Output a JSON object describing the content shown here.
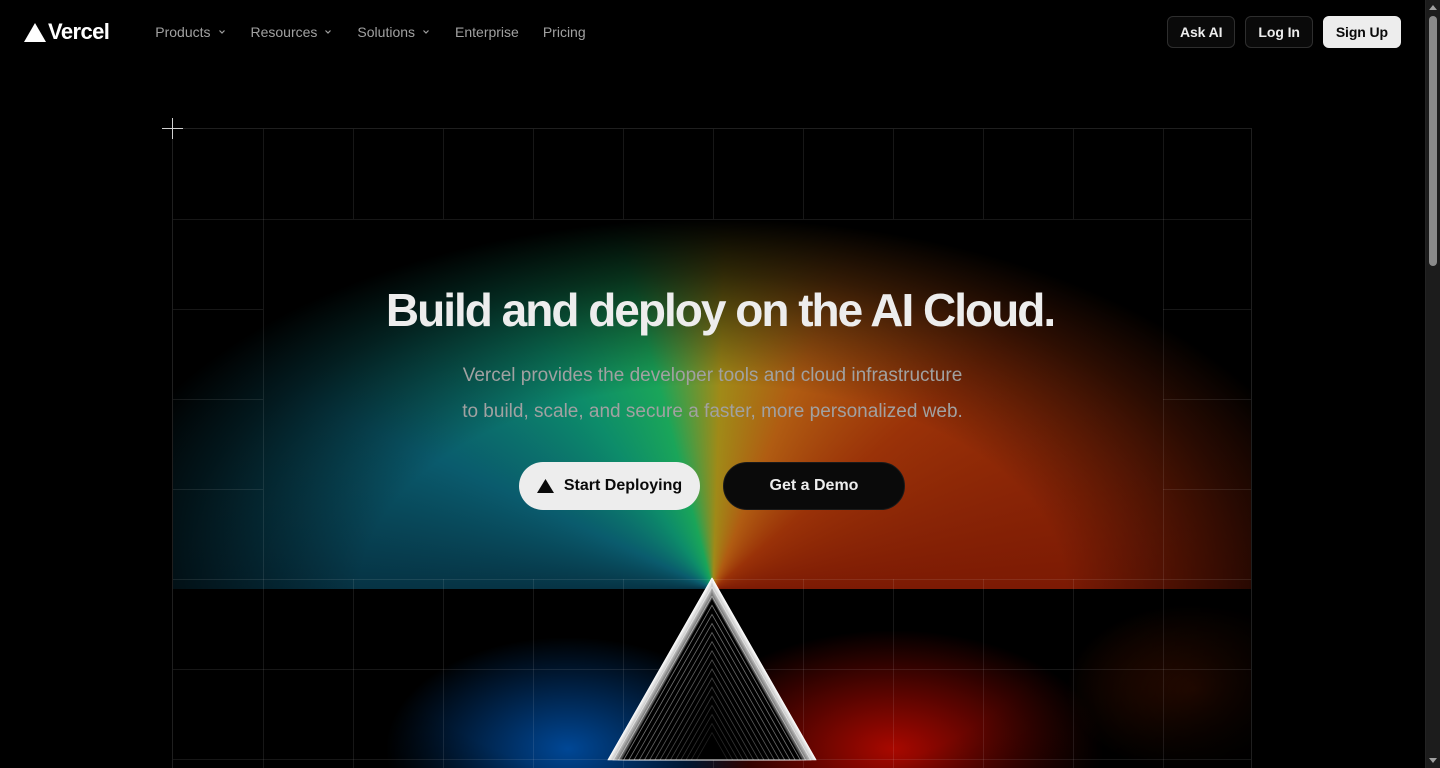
{
  "nav": {
    "logo_text": "Vercel",
    "items": [
      {
        "label": "Products",
        "has_dropdown": true
      },
      {
        "label": "Resources",
        "has_dropdown": true
      },
      {
        "label": "Solutions",
        "has_dropdown": true
      },
      {
        "label": "Enterprise",
        "has_dropdown": false
      },
      {
        "label": "Pricing",
        "has_dropdown": false
      }
    ],
    "ask_ai": "Ask AI",
    "login": "Log In",
    "signup": "Sign Up"
  },
  "hero": {
    "headline": "Build and deploy on the AI Cloud.",
    "subtitle_line1": "Vercel provides the developer tools and cloud infrastructure",
    "subtitle_line2": "to build, scale, and secure a faster, more personalized web.",
    "cta_primary": "Start Deploying",
    "cta_secondary": "Get a Demo"
  },
  "icons": {
    "logo": "triangle-logo-icon",
    "dropdown": "chevron-down-icon",
    "cta_primary": "triangle-icon"
  },
  "colors": {
    "background": "#000000",
    "text": "#ededed",
    "muted": "#a1a1a1",
    "button_light": "#ededed"
  }
}
